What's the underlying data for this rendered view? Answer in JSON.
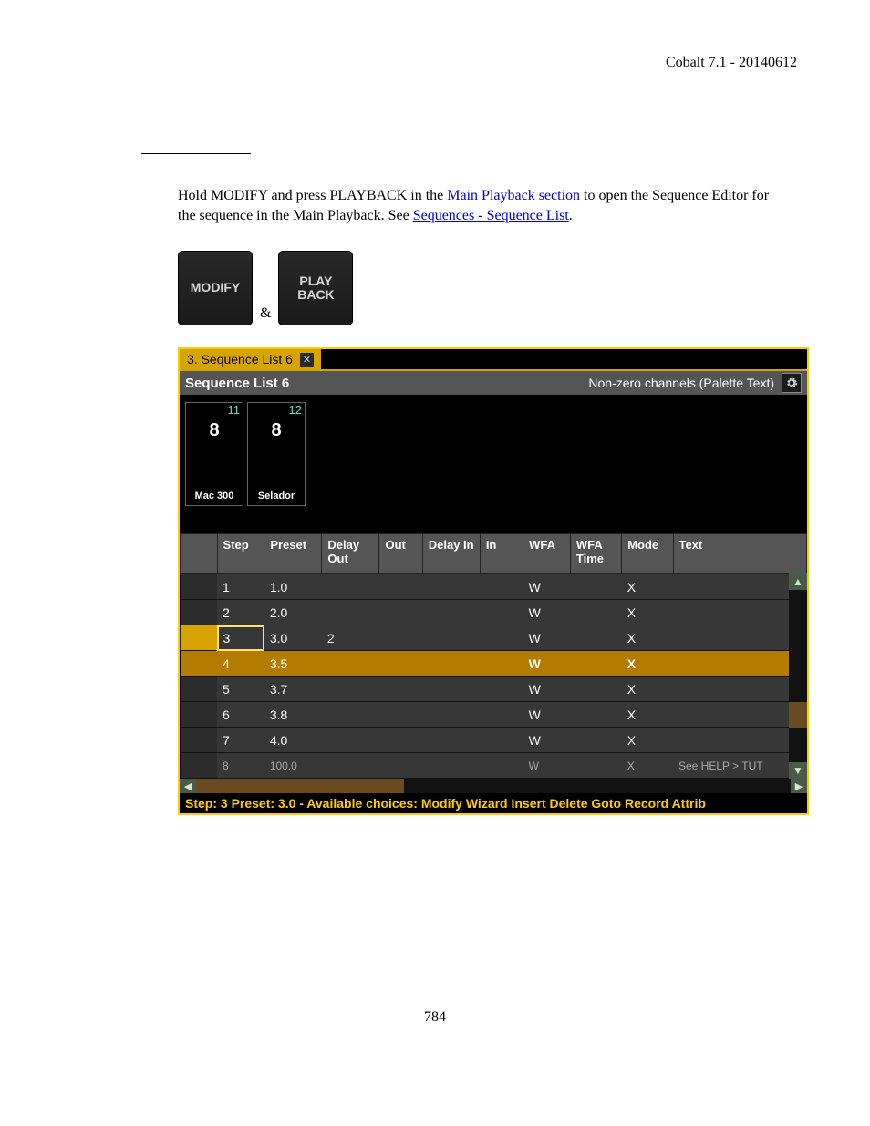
{
  "header": {
    "version": "Cobalt 7.1 - 20140612"
  },
  "body": {
    "text_pre": "Hold MODIFY and press PLAYBACK in the ",
    "link1": "Main Playback section",
    "text_mid": " to open the Sequence Editor for the sequence in the Main Playback. See ",
    "link2": "Sequences - Sequence List",
    "text_post": "."
  },
  "keys": {
    "modify": "MODIFY",
    "amp": "&",
    "playback": "PLAY\nBACK"
  },
  "screenshot": {
    "tab_label": "3. Sequence List 6",
    "title": "Sequence List 6",
    "right_label": "Non-zero channels (Palette Text)",
    "channels": [
      {
        "num": "11",
        "val": "8",
        "lbl": "Mac 300"
      },
      {
        "num": "12",
        "val": "8",
        "lbl": "Selador"
      }
    ],
    "columns": [
      "",
      "Step",
      "Preset",
      "Delay Out",
      "Out",
      "Delay In",
      "In",
      "WFA",
      "WFA Time",
      "Mode",
      "Text"
    ],
    "rows": [
      {
        "step": "1",
        "preset": "1.0",
        "delay_out": "",
        "wfa": "W",
        "mode": "X",
        "text": "",
        "selected": false,
        "highlighted": false
      },
      {
        "step": "2",
        "preset": "2.0",
        "delay_out": "",
        "wfa": "W",
        "mode": "X",
        "text": "",
        "selected": false,
        "highlighted": false
      },
      {
        "step": "3",
        "preset": "3.0",
        "delay_out": "2",
        "wfa": "W",
        "mode": "X",
        "text": "",
        "selected": true,
        "highlighted": false
      },
      {
        "step": "4",
        "preset": "3.5",
        "delay_out": "",
        "wfa": "W",
        "mode": "X",
        "text": "",
        "selected": false,
        "highlighted": true
      },
      {
        "step": "5",
        "preset": "3.7",
        "delay_out": "",
        "wfa": "W",
        "mode": "X",
        "text": "",
        "selected": false,
        "highlighted": false
      },
      {
        "step": "6",
        "preset": "3.8",
        "delay_out": "",
        "wfa": "W",
        "mode": "X",
        "text": "",
        "selected": false,
        "highlighted": false
      },
      {
        "step": "7",
        "preset": "4.0",
        "delay_out": "",
        "wfa": "W",
        "mode": "X",
        "text": "",
        "selected": false,
        "highlighted": false
      },
      {
        "step": "8",
        "preset": "100.0",
        "delay_out": "",
        "wfa": "W",
        "mode": "X",
        "text": "See HELP > TUT",
        "selected": false,
        "highlighted": false,
        "cut": true
      }
    ],
    "status": "Step: 3 Preset: 3.0 - Available choices: Modify Wizard Insert Delete Goto Record Attrib"
  },
  "page_number": "784"
}
